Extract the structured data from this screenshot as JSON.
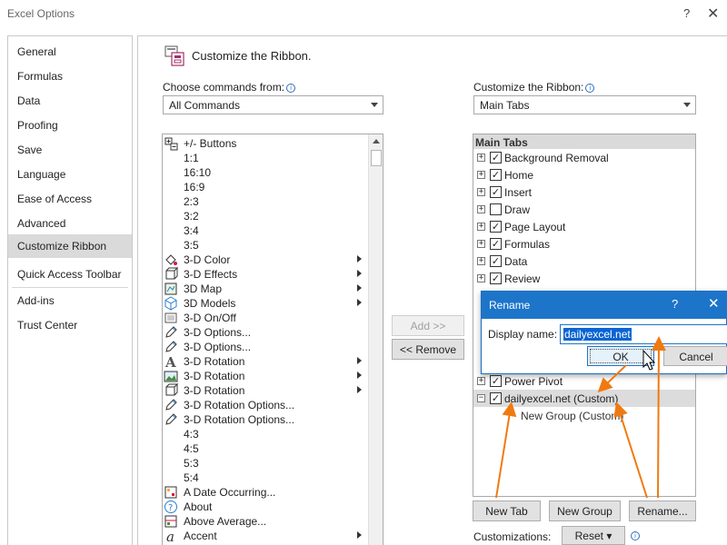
{
  "window": {
    "title": "Excel Options",
    "help_glyph": "?",
    "close_glyph": "✕"
  },
  "nav": {
    "items": [
      {
        "label": "General"
      },
      {
        "label": "Formulas"
      },
      {
        "label": "Data"
      },
      {
        "label": "Proofing"
      },
      {
        "label": "Save"
      },
      {
        "label": "Language"
      },
      {
        "label": "Ease of Access"
      },
      {
        "label": "Advanced"
      },
      {
        "label": "Customize Ribbon"
      },
      {
        "label": "Quick Access Toolbar"
      },
      {
        "label": "Add-ins"
      },
      {
        "label": "Trust Center"
      }
    ],
    "active_index": 8
  },
  "heading": "Customize the Ribbon.",
  "left": {
    "choose_label": "Choose commands from:",
    "choose_value": "All Commands",
    "commands": [
      {
        "label": "+/- Buttons",
        "icon": "plus-minus-icon",
        "sub": false
      },
      {
        "label": "1:1",
        "icon": "",
        "sub": false
      },
      {
        "label": "16:10",
        "icon": "",
        "sub": false
      },
      {
        "label": "16:9",
        "icon": "",
        "sub": false
      },
      {
        "label": "2:3",
        "icon": "",
        "sub": false
      },
      {
        "label": "3:2",
        "icon": "",
        "sub": false
      },
      {
        "label": "3:4",
        "icon": "",
        "sub": false
      },
      {
        "label": "3:5",
        "icon": "",
        "sub": false
      },
      {
        "label": "3-D Color",
        "icon": "paint-bucket-icon",
        "sub": true
      },
      {
        "label": "3-D Effects",
        "icon": "cube-icon",
        "sub": true
      },
      {
        "label": "3D Map",
        "icon": "map-icon",
        "sub": true
      },
      {
        "label": "3D Models",
        "icon": "model-icon",
        "sub": true
      },
      {
        "label": "3-D On/Off",
        "icon": "3d-toggle-icon",
        "sub": false
      },
      {
        "label": "3-D Options...",
        "icon": "pencil-icon",
        "sub": false
      },
      {
        "label": "3-D Options...",
        "icon": "pencil-icon",
        "sub": false
      },
      {
        "label": "3-D Rotation",
        "icon": "letter-a-icon",
        "sub": true
      },
      {
        "label": "3-D Rotation",
        "icon": "picture-icon",
        "sub": true
      },
      {
        "label": "3-D Rotation",
        "icon": "cube-icon",
        "sub": true
      },
      {
        "label": "3-D Rotation Options...",
        "icon": "pencil-icon",
        "sub": false
      },
      {
        "label": "3-D Rotation Options...",
        "icon": "pencil-icon",
        "sub": false
      },
      {
        "label": "4:3",
        "icon": "",
        "sub": false
      },
      {
        "label": "4:5",
        "icon": "",
        "sub": false
      },
      {
        "label": "5:3",
        "icon": "",
        "sub": false
      },
      {
        "label": "5:4",
        "icon": "",
        "sub": false
      },
      {
        "label": "A Date Occurring...",
        "icon": "conditional-format-icon",
        "sub": false
      },
      {
        "label": "About",
        "icon": "question-icon",
        "sub": false
      },
      {
        "label": "Above Average...",
        "icon": "above-average-icon",
        "sub": false
      },
      {
        "label": "Accent",
        "icon": "accent-icon",
        "sub": true
      }
    ]
  },
  "middle": {
    "add_label": "Add >>",
    "remove_label": "<< Remove"
  },
  "right": {
    "customize_label": "Customize the Ribbon:",
    "customize_value": "Main Tabs",
    "tree_header": "Main Tabs",
    "tabs": [
      {
        "label": "Background Removal",
        "checked": true,
        "expander": "+"
      },
      {
        "label": "Home",
        "checked": true,
        "expander": "+"
      },
      {
        "label": "Insert",
        "checked": true,
        "expander": "+"
      },
      {
        "label": "Draw",
        "checked": false,
        "expander": "+"
      },
      {
        "label": "Page Layout",
        "checked": true,
        "expander": "+"
      },
      {
        "label": "Formulas",
        "checked": true,
        "expander": "+"
      },
      {
        "label": "Data",
        "checked": true,
        "expander": "+"
      },
      {
        "label": "Review",
        "checked": true,
        "expander": "+"
      },
      {
        "label": "Power Pivot",
        "checked": true,
        "expander": "+"
      },
      {
        "label": "dailyexcel.net (Custom)",
        "checked": true,
        "expander": "−",
        "selected": true
      }
    ],
    "child_group": "New Group (Custom)",
    "new_tab_label": "New Tab",
    "new_group_label": "New Group",
    "rename_label": "Rename...",
    "customizations_label": "Customizations:",
    "reset_label": "Reset ▾"
  },
  "rename_dialog": {
    "title": "Rename",
    "help_glyph": "?",
    "close_glyph": "✕",
    "display_name_label": "Display name:",
    "display_name_value": "dailyexcel.net",
    "ok_label": "OK",
    "cancel_label": "Cancel"
  },
  "colors": {
    "accent": "#1d75c9",
    "arrow": "#f07a10",
    "nav_active": "#dadada"
  }
}
